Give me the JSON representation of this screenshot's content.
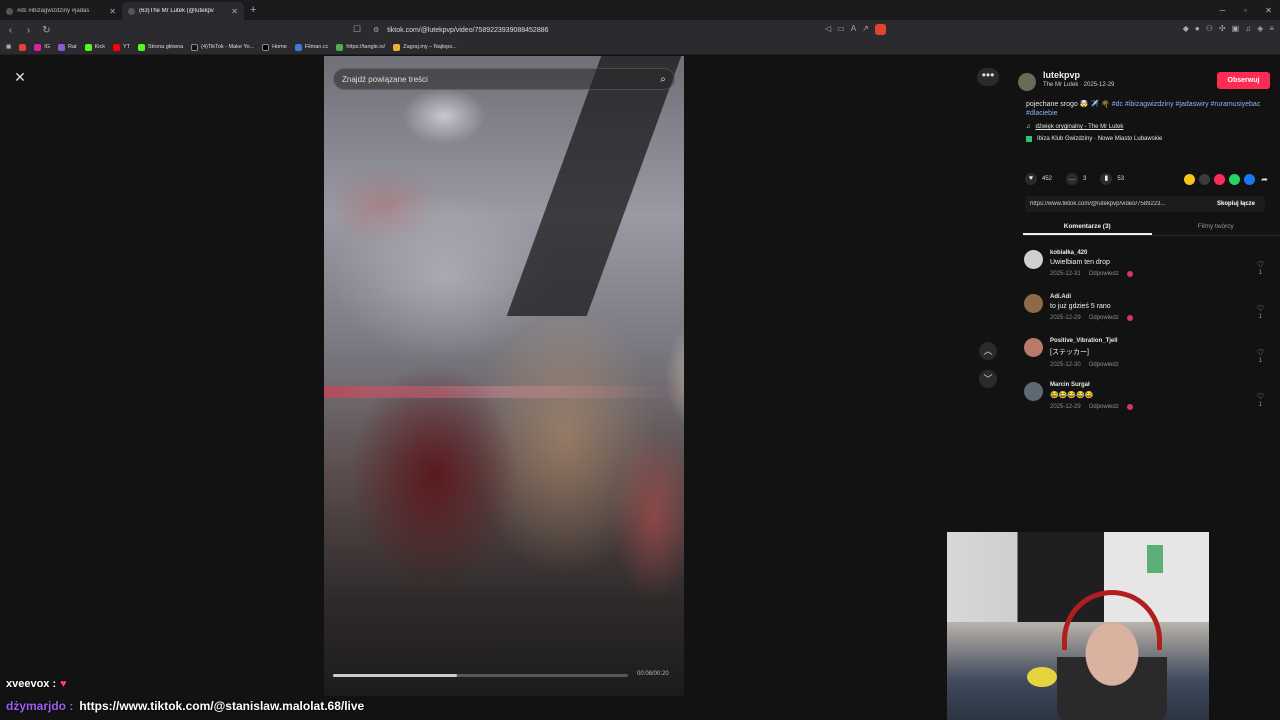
{
  "browser": {
    "tabs": [
      {
        "title": "#dc #ibizagwizdziny #jadas"
      },
      {
        "title": "(63)The Mr Lutek (@lutekpv"
      }
    ],
    "url": "tiktok.com/@lutekpvp/video/7589223939088452886",
    "bookmarks": [
      "IG",
      "Rat",
      "Kick",
      "YT",
      "Strona główna",
      "(4)TikTok - Make Yo...",
      "Home",
      "Filman.cc",
      "https://tangle.io/",
      "Zagraj.my – Najleps..."
    ]
  },
  "video": {
    "search_placeholder": "Znajdź powiązane treści",
    "progress_fraction": 0.42,
    "timecode": "00:08/00:20"
  },
  "post": {
    "username": "lutekpvp",
    "subline": "The Mr Lutek · 2025-12-29",
    "follow_label": "Obserwuj",
    "desc_text": "pojechane srogo 🤯 ✈️ 🌴 ",
    "desc_tags": "#dc #ibizagwizdziny #jadaswiry #ruramusiyebac #dlaciebie",
    "music": "dźwięk oryginalny - The Mr Lutek",
    "location": "Ibiza Klub Gwizdziny · Nowe Miasto Lubawskie",
    "likes": "452",
    "comments_count": "3",
    "saves": "53",
    "link": "https://www.tiktok.com/@lutekpvp/video/7589223...",
    "copy_label": "Skopiuj łącze",
    "tab_comments": "Komentarze (3)",
    "tab_videos": "Filmy twórcy"
  },
  "comments": [
    {
      "user": "kobiałka_420",
      "text": "Uwielbiam ten drop",
      "date": "2025-12-31",
      "reply": "Odpowiedz",
      "likes": "1",
      "avatar_color": "#cfcfcf"
    },
    {
      "user": "Adi.Adi",
      "text": "to już gdzieś 5 rano",
      "date": "2025-12-29",
      "reply": "Odpowiedz",
      "likes": "1",
      "avatar_color": "#8d6b48"
    },
    {
      "user": "Positive_Vibration_Tjell",
      "text": "[ステッカー]",
      "date": "2025-12-30",
      "reply": "Odpowiedz",
      "likes": "1",
      "avatar_color": "#b87a6a"
    },
    {
      "user": "Marcin Surgał",
      "text": "😂😂😂😂😂",
      "date": "2025-12-29",
      "reply": "Odpowiedz",
      "likes": "1",
      "avatar_color": "#5c6a74"
    }
  ],
  "stream_chat": {
    "line1_user": "xveevox :",
    "line2_user": "dżymarjdo :",
    "line2_text": "https://www.tiktok.com/@stanislaw.malolat.68/live"
  }
}
